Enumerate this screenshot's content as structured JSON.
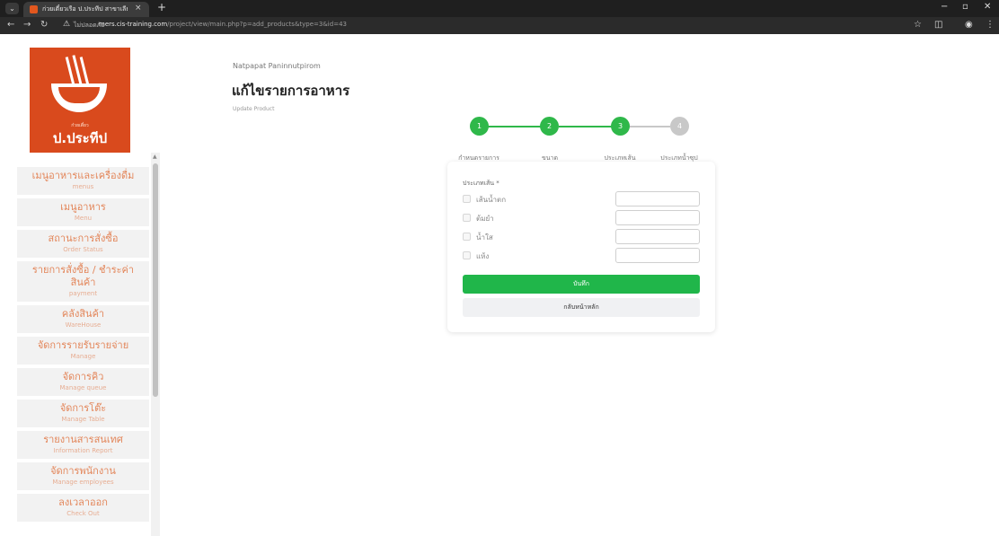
{
  "browser": {
    "tab_title": "ก่วยเตี๋ยวเรือ ป.ประทีป สาขาเลียบแม...",
    "tab_close": "×",
    "new_tab": "+",
    "url_warning": "ไม่ปลอดภัย",
    "url_host": "mers.cis-training.com",
    "url_path": "/project/view/main.php?p=add_products&type=3&id=43"
  },
  "logo": {
    "small_text": "ก๋วยเตี๋ยว",
    "name": "ป.ประทีป"
  },
  "sidebar": {
    "items": [
      {
        "th": "เมนูอาหารและเครื่องดื่ม",
        "en": "menus"
      },
      {
        "th": "เมนูอาหาร",
        "en": "Menu"
      },
      {
        "th": "สถานะการสั่งซื้อ",
        "en": "Order Status"
      },
      {
        "th": "รายการสั่งซื้อ / ชำระค่าสินค้า",
        "en": "payment"
      },
      {
        "th": "คลังสินค้า",
        "en": "WareHouse"
      },
      {
        "th": "จัดการรายรับรายจ่าย",
        "en": "Manage"
      },
      {
        "th": "จัดการคิว",
        "en": "Manage queue"
      },
      {
        "th": "จัดการโต๊ะ",
        "en": "Manage Table"
      },
      {
        "th": "รายงานสารสนเทศ",
        "en": "Information Report"
      },
      {
        "th": "จัดการพนักงาน",
        "en": "Manage employees"
      },
      {
        "th": "ลงเวลาออก",
        "en": "Check Out"
      }
    ]
  },
  "header": {
    "user_name": "Natpapat Paninnutpirom",
    "title": "แก้ไขรายการอาหาร",
    "subtitle": "Update Product"
  },
  "stepper": {
    "steps": [
      {
        "num": "1",
        "label": "กำหนดรายการ",
        "done": true
      },
      {
        "num": "2",
        "label": "ขนาด",
        "done": true
      },
      {
        "num": "3",
        "label": "ประเภทเส้น",
        "done": true
      },
      {
        "num": "4",
        "label": "ประเภทน้ำซุป",
        "done": false
      }
    ],
    "active_color": "#2fb84a",
    "inactive_color": "#c8c8c8"
  },
  "form": {
    "field_label": "ประเภทเส้น *",
    "options": [
      {
        "label": "เส้นน้ำตก",
        "value": ""
      },
      {
        "label": "ต้มยำ",
        "value": ""
      },
      {
        "label": "น้ำใส",
        "value": ""
      },
      {
        "label": "แห้ง",
        "value": ""
      }
    ],
    "save_label": "บันทึก",
    "back_label": "กลับหน้าหลัก"
  }
}
